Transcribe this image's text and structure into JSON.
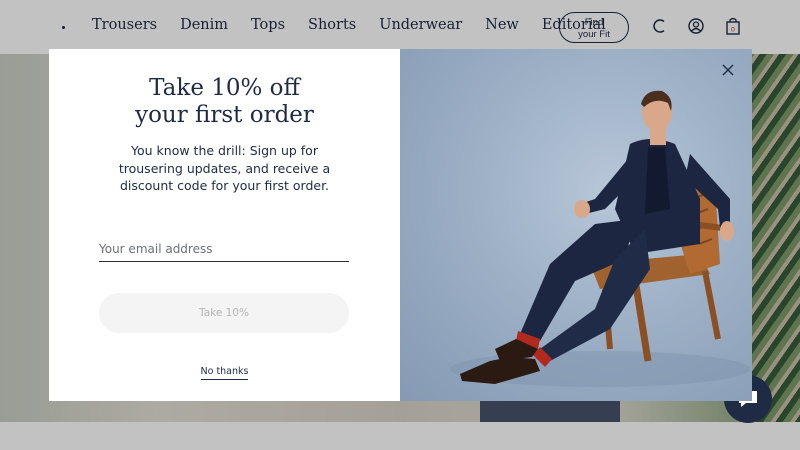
{
  "nav": {
    "items": [
      "Trousers",
      "Denim",
      "Tops",
      "Shorts",
      "Underwear",
      "New",
      "Editorial"
    ],
    "find_fit_line1": "Find",
    "find_fit_line2": "your Fit",
    "icons": [
      "search-icon",
      "account-icon",
      "bag-icon"
    ],
    "bag_count": "0"
  },
  "modal": {
    "title_line1": "Take 10% off",
    "title_line2": "your first order",
    "body": "You know the drill: Sign up for trousering updates, and receive a discount code for your first order.",
    "email_placeholder": "Your email address",
    "email_value": "",
    "cta_label": "Take 10%",
    "dismiss_label": "No thanks",
    "close_icon": "close-icon"
  },
  "colors": {
    "navy": "#1f2a44",
    "overlay": "rgba(0,0,0,0.24)",
    "cta_disabled_bg": "#f4f4f4",
    "cta_disabled_text": "#b5b5b5"
  },
  "chat": {
    "icon": "chat-icon"
  }
}
